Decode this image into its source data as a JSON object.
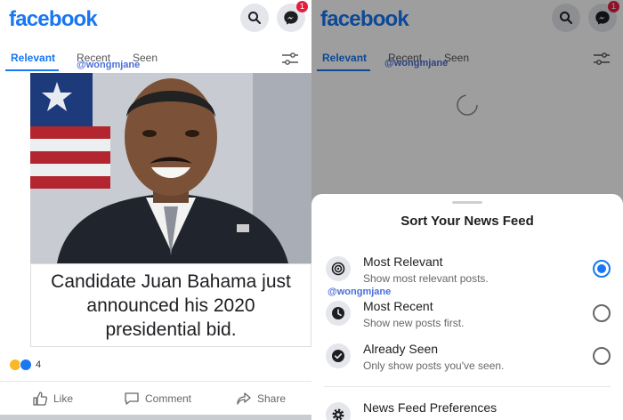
{
  "feed": {
    "logo": "facebook",
    "notification_count": "1",
    "tabs": [
      "Relevant",
      "Recent",
      "Seen"
    ],
    "watermark": "@wongmjane",
    "post": {
      "caption": "Candidate Juan Bahama just announced his 2020 presidential bid.",
      "reaction_count": "4",
      "actions": [
        "Like",
        "Comment",
        "Share"
      ]
    }
  },
  "sort_sheet": {
    "title": "Sort Your News Feed",
    "watermark": "@wongmjane",
    "options": [
      {
        "label": "Most Relevant",
        "description": "Show most relevant posts.",
        "selected": true
      },
      {
        "label": "Most Recent",
        "description": "Show new posts first.",
        "selected": false
      },
      {
        "label": "Already Seen",
        "description": "Only show posts you've seen.",
        "selected": false
      }
    ],
    "preferences": {
      "label": "News Feed Preferences"
    }
  },
  "colors": {
    "brand": "#1877f2",
    "badge": "#e41e3f",
    "text_secondary": "#65676b"
  }
}
